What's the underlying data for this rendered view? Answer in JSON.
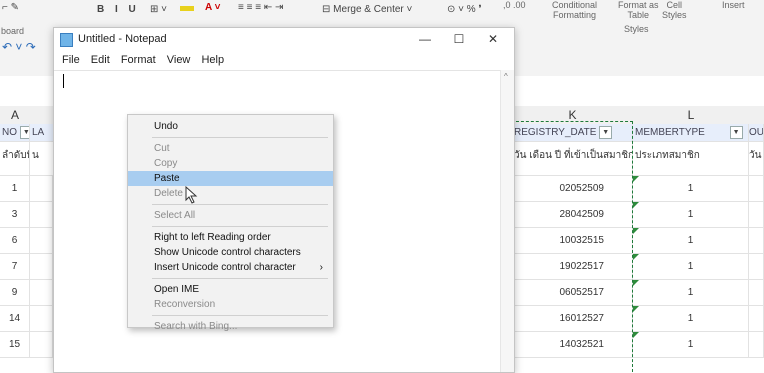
{
  "excel": {
    "ribbon": {
      "font_buttons": "B  I  U",
      "merge_label": "Merge & Center",
      "percent_label": "%",
      "cond_formatting_line1": "Conditional",
      "cond_formatting_line2": "Formatting",
      "format_as_line1": "Format as",
      "format_as_line2": "Table",
      "cell_line1": "Cell",
      "cell_line2": "Styles",
      "insert_label": "Insert",
      "styles_group": "Styles",
      "clipboard_group": "board"
    },
    "columns": {
      "a": "A",
      "k": "K",
      "l": "L"
    },
    "header_row": {
      "col_a": "NO",
      "col_b": "LA",
      "col_k": "REGISTRY_DATE",
      "col_l": "MEMBERTYPE",
      "col_m": "OU"
    },
    "thai_row": {
      "col_a": "ลำดับที่",
      "col_b": "น",
      "col_k": "วัน เดือน ปี ที่เข้าเป็นสมาชิก",
      "col_l": "ประเภทสมาชิก",
      "col_m": "วัน"
    },
    "rows": [
      {
        "no": "1",
        "date": "02052509",
        "type": "1"
      },
      {
        "no": "3",
        "date": "28042509",
        "type": "1"
      },
      {
        "no": "6",
        "date": "10032515",
        "type": "1"
      },
      {
        "no": "7",
        "date": "19022517",
        "type": "1"
      },
      {
        "no": "9",
        "date": "06052517",
        "type": "1"
      },
      {
        "no": "14",
        "date": "16012527",
        "type": "1"
      },
      {
        "no": "15",
        "date": "14032521",
        "type": "1"
      }
    ]
  },
  "notepad": {
    "title": "Untitled - Notepad",
    "menu": [
      "File",
      "Edit",
      "Format",
      "View",
      "Help"
    ],
    "minimize": "—",
    "maximize": "☐",
    "close": "✕"
  },
  "context_menu": {
    "items": [
      {
        "label": "Undo",
        "disabled": false
      },
      {
        "label": "Cut",
        "disabled": true
      },
      {
        "label": "Copy",
        "disabled": true
      },
      {
        "label": "Paste",
        "disabled": false,
        "highlighted": true
      },
      {
        "label": "Delete",
        "disabled": true
      },
      {
        "label": "Select All",
        "disabled": true
      },
      {
        "label": "Right to left Reading order",
        "disabled": false
      },
      {
        "label": "Show Unicode control characters",
        "disabled": false
      },
      {
        "label": "Insert Unicode control character",
        "disabled": false,
        "submenu": "›"
      },
      {
        "label": "Open IME",
        "disabled": false
      },
      {
        "label": "Reconversion",
        "disabled": true
      },
      {
        "label": "Search with Bing...",
        "disabled": true
      }
    ]
  }
}
